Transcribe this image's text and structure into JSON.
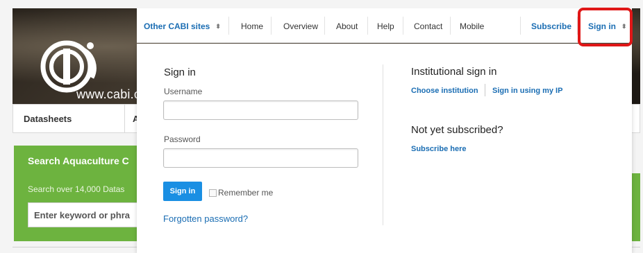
{
  "logo": {
    "text": "www.cabi.org"
  },
  "tabs": {
    "first": "Datasheets",
    "second": "A"
  },
  "search": {
    "title": "Search Aquaculture C",
    "subtitle": "Search over 14,000 Datas",
    "placeholder": "Enter keyword or phra"
  },
  "nav": {
    "other_sites": "Other CABI sites",
    "home": "Home",
    "overview": "Overview",
    "about": "About",
    "help": "Help",
    "contact": "Contact",
    "mobile": "Mobile",
    "subscribe": "Subscribe",
    "sign_in": "Sign in",
    "updown_glyph": "⬍"
  },
  "signin_form": {
    "heading": "Sign in",
    "username_label": "Username",
    "username_value": "",
    "password_label": "Password",
    "password_value": "",
    "submit_label": "Sign in",
    "remember_label": "Remember me",
    "forgot_label": "Forgotten password?"
  },
  "institutional": {
    "heading": "Institutional sign in",
    "choose_label": "Choose institution",
    "ip_label": "Sign in using my IP",
    "not_subscribed_heading": "Not yet subscribed?",
    "subscribe_here_label": "Subscribe here"
  },
  "colors": {
    "link_blue": "#1a6db3",
    "button_blue": "#1a8fe3",
    "highlight_red": "#e01717",
    "search_green": "#6db33f"
  }
}
